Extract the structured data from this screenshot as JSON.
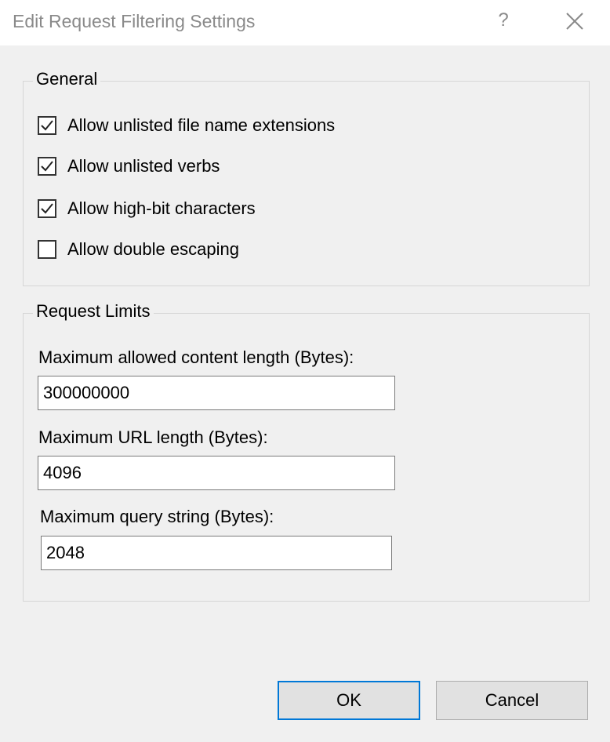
{
  "window": {
    "title": "Edit Request Filtering Settings",
    "help_glyph": "?",
    "close_icon": "close-icon"
  },
  "general": {
    "legend": "General",
    "options": [
      {
        "label": "Allow unlisted file name extensions",
        "checked": true
      },
      {
        "label": "Allow unlisted verbs",
        "checked": true
      },
      {
        "label": "Allow high-bit characters",
        "checked": true
      },
      {
        "label": "Allow double escaping",
        "checked": false
      }
    ]
  },
  "limits": {
    "legend": "Request Limits",
    "content_length": {
      "label": "Maximum allowed content length (Bytes):",
      "value": "300000000"
    },
    "url_length": {
      "label": "Maximum URL length (Bytes):",
      "value": "4096"
    },
    "query_string": {
      "label": "Maximum query string (Bytes):",
      "value": "2048"
    }
  },
  "buttons": {
    "ok": "OK",
    "cancel": "Cancel"
  },
  "colors": {
    "default_button_border": "#0078d7",
    "dialog_background": "#f0f0f0"
  }
}
